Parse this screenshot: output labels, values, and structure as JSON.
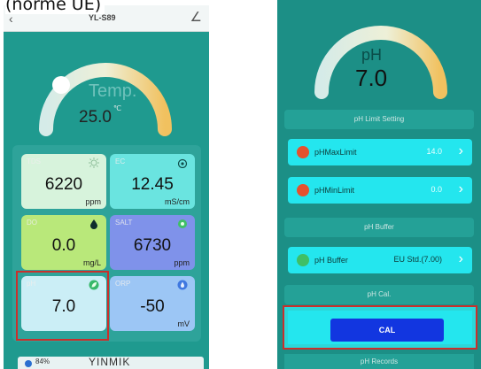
{
  "caption": "(norme UE)",
  "left_screen": {
    "header": {
      "back_icon": "chevron-left-icon",
      "device_name": "YL-S89",
      "edit_icon": "pencil-icon"
    },
    "temperature": {
      "label": "Temp.",
      "value": "25.0",
      "unit": "℃"
    },
    "cards": [
      {
        "id": "tds",
        "label": "TDS",
        "value": "6220",
        "unit": "ppm",
        "icon": "sun-icon"
      },
      {
        "id": "ec",
        "label": "EC",
        "value": "12.45",
        "unit": "mS/cm",
        "icon": "drop-icon"
      },
      {
        "id": "do",
        "label": "DO",
        "value": "0.0",
        "unit": "mg/L",
        "icon": "oxygen-drop-icon"
      },
      {
        "id": "salt",
        "label": "SALT",
        "value": "6730",
        "unit": "ppm",
        "icon": "salt-icon"
      },
      {
        "id": "ph",
        "label": "pH",
        "value": "7.0",
        "unit": "",
        "icon": "leaf-icon"
      },
      {
        "id": "orp",
        "label": "ORP",
        "value": "-50",
        "unit": "mV",
        "icon": "orp-drop-icon"
      }
    ],
    "bottom": {
      "battery": "84%",
      "brand": "YINMIK"
    }
  },
  "right_screen": {
    "ph_title": "pH",
    "ph_value": "7.0",
    "limit_header": "pH Limit Setting",
    "max_limit": {
      "label": "pHMaxLimit",
      "value": "14.0"
    },
    "min_limit": {
      "label": "pHMinLimit",
      "value": "0.0"
    },
    "buffer_header": "pH Buffer",
    "buffer": {
      "label": "pH Buffer",
      "value": "EU Std.(7.00)"
    },
    "cal_header": "pH Cal.",
    "cal_button": "CAL",
    "records_header": "pH Records"
  },
  "colors": {
    "teal_bg": "#1f9a8f",
    "cyan_row": "#24e6ee",
    "cal_blue": "#1236e0",
    "highlight_red": "#c9302c"
  }
}
